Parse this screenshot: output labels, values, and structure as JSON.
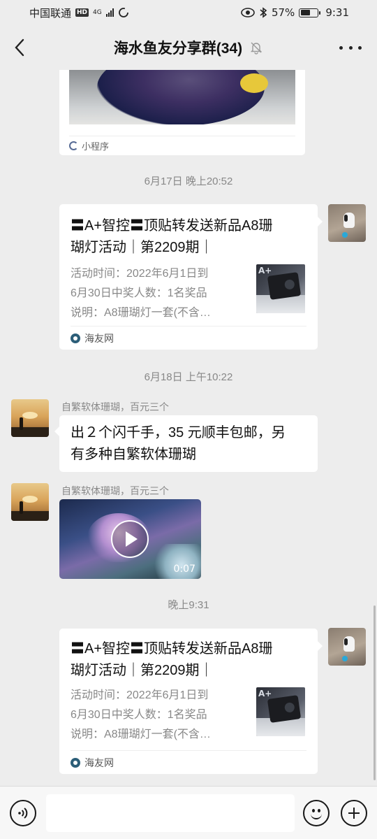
{
  "status_bar": {
    "carrier": "中国联通",
    "network": "4G",
    "battery": "57%",
    "battery_level": 0.57,
    "time": "9:31"
  },
  "header": {
    "title": "海水鱼友分享群(34)",
    "icons": [
      "back-arrow-icon",
      "mute-bell-icon",
      "more-icon"
    ]
  },
  "messages": [
    {
      "type": "mini_program_card",
      "footer": "小程序"
    },
    {
      "type": "timestamp",
      "text": "6月17日 晚上20:52"
    },
    {
      "type": "link_card",
      "side": "right",
      "title": "〓A+智控〓顶贴转发送新品A8珊瑚灯活动｜第2209期｜",
      "title_lines": [
        "〓A+智控〓顶贴转发送新品A8珊",
        "瑚灯活动｜第2209期｜"
      ],
      "desc_lines": [
        "活动时间：2022年6月1日到",
        "6月30日中奖人数：1名奖品",
        "说明：A8珊瑚灯一套(不含…"
      ],
      "thumb_label": "A+",
      "source": "海友网"
    },
    {
      "type": "timestamp",
      "text": "6月18日 上午10:22"
    },
    {
      "type": "text",
      "side": "left",
      "sender": "自繁软体珊瑚，百元三个",
      "text_lines": [
        "出２个闪千手，35 元顺丰包邮，另",
        "有多种自繁软体珊瑚"
      ]
    },
    {
      "type": "video",
      "side": "left",
      "sender": "自繁软体珊瑚，百元三个",
      "duration": "0:07"
    },
    {
      "type": "timestamp",
      "text": "晚上9:31"
    },
    {
      "type": "link_card",
      "side": "right",
      "title_lines": [
        "〓A+智控〓顶贴转发送新品A8珊",
        "瑚灯活动｜第2209期｜"
      ],
      "desc_lines": [
        "活动时间：2022年6月1日到",
        "6月30日中奖人数：1名奖品",
        "说明：A8珊瑚灯一套(不含…"
      ],
      "thumb_label": "A+",
      "source": "海友网"
    }
  ],
  "input_bar": {
    "placeholder": "",
    "icons": [
      "voice-icon",
      "emoji-icon",
      "plus-icon"
    ]
  },
  "colors": {
    "background": "#ededed",
    "bubble": "#ffffff",
    "meta_text": "#888888"
  }
}
